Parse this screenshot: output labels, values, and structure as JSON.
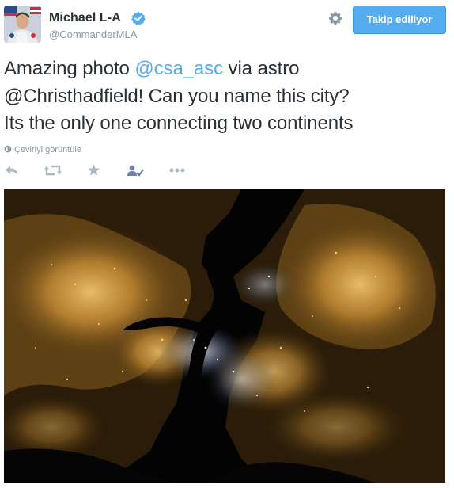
{
  "tweet": {
    "author": {
      "display_name": "Michael L-A",
      "handle": "@CommanderMLA",
      "verified": true,
      "avatar_icon": "astronaut-avatar"
    },
    "follow_button": {
      "label": "Takip ediliyor"
    },
    "settings_icon": "gear-icon",
    "text": {
      "line1": {
        "prefix": "Amazing photo ",
        "mention": "@csa_asc",
        "suffix": " via astro"
      },
      "line2": {
        "mention": "@Christhadfield",
        "suffix": "! Can you name this city?"
      },
      "line3": {
        "text": "Its the only one connecting two continents"
      }
    },
    "translate_label": "Çeviriyi görüntüle",
    "actions": [
      "reply-icon",
      "retweet-icon",
      "favorite-icon",
      "follow-user-icon",
      "more-icon"
    ],
    "photo_alt_icon": "night-city-photo"
  },
  "colors": {
    "text": "#292f33",
    "muted": "#8899a6",
    "link": "#55acee",
    "button_bg": "#55acee",
    "action_icon": "#aab8c2",
    "photo_bg": "#030303",
    "city_lights": "#f0b040"
  }
}
